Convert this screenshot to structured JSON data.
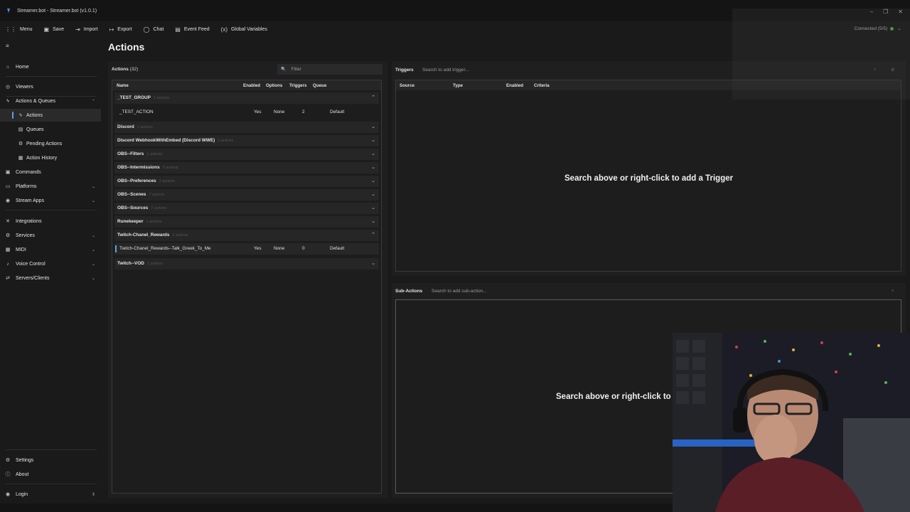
{
  "window": {
    "title": "Streamer.bot - Streamer.bot (v1.0.1)",
    "minimize": "–",
    "restore": "❐",
    "close": "✕"
  },
  "menubar": {
    "items": [
      {
        "icon": "grid-icon",
        "glyph": "⋮⋮",
        "label": "Menu"
      },
      {
        "icon": "save-icon",
        "glyph": "▣",
        "label": "Save"
      },
      {
        "icon": "import-icon",
        "glyph": "⇥",
        "label": "Import"
      },
      {
        "icon": "export-icon",
        "glyph": "↦",
        "label": "Export"
      },
      {
        "icon": "chat-icon",
        "glyph": "◯",
        "label": "Chat"
      },
      {
        "icon": "event-feed-icon",
        "glyph": "▤",
        "label": "Event Feed"
      },
      {
        "icon": "variables-icon",
        "glyph": "(x)",
        "label": "Global Variables"
      }
    ],
    "connection": "Connected (5/5)"
  },
  "sidebar": {
    "toggle": "≡",
    "items": [
      {
        "label": "Home",
        "icon": "home-icon",
        "glyph": "⌂"
      },
      {
        "label": "Viewers",
        "icon": "viewers-icon",
        "glyph": "◎"
      },
      {
        "label": "Actions & Queues",
        "icon": "lightning-icon",
        "glyph": "ϟ",
        "chev": "⌃"
      },
      {
        "label": "Actions",
        "icon": "lightning-icon",
        "glyph": "ϟ"
      },
      {
        "label": "Queues",
        "icon": "queue-icon",
        "glyph": "▤"
      },
      {
        "label": "Pending Actions",
        "icon": "pending-icon",
        "glyph": "⚙"
      },
      {
        "label": "Action History",
        "icon": "history-icon",
        "glyph": "▦"
      },
      {
        "label": "Commands",
        "icon": "commands-icon",
        "glyph": "▣"
      },
      {
        "label": "Platforms",
        "icon": "platforms-icon",
        "glyph": "▭",
        "chev": "⌄"
      },
      {
        "label": "Stream Apps",
        "icon": "stream-apps-icon",
        "glyph": "◉",
        "chev": "⌄"
      },
      {
        "label": "Integrations",
        "icon": "integrations-icon",
        "glyph": "✕"
      },
      {
        "label": "Services",
        "icon": "services-icon",
        "glyph": "⚙",
        "chev": "⌄"
      },
      {
        "label": "MIDI",
        "icon": "midi-icon",
        "glyph": "▦",
        "chev": "⌄"
      },
      {
        "label": "Voice Control",
        "icon": "mic-icon",
        "glyph": "♪",
        "chev": "⌄"
      },
      {
        "label": "Servers/Clients",
        "icon": "servers-icon",
        "glyph": "⇄",
        "chev": "⌄"
      },
      {
        "label": "Settings",
        "icon": "settings-icon",
        "glyph": "⚙"
      },
      {
        "label": "About",
        "icon": "about-icon",
        "glyph": "ⓘ"
      },
      {
        "label": "Login",
        "icon": "user-icon",
        "glyph": "◉",
        "chev": "⇕"
      }
    ]
  },
  "main": {
    "title": "Actions"
  },
  "actions": {
    "header": "Actions",
    "count": "(32)",
    "filter_placeholder": "Filter",
    "search_glyph": "🔍",
    "columns": [
      "Name",
      "Enabled",
      "Options",
      "Triggers",
      "Queue"
    ],
    "groups": [
      {
        "name": "_TEST_GROUP",
        "sub": "1 actions",
        "chev": "⌃"
      },
      {
        "name": "Discord",
        "sub": "1 actions",
        "chev": "⌄"
      },
      {
        "name": "Discord WebhookWithEmbed (Discord WWE)",
        "sub": "1 actions",
        "chev": "⌄"
      },
      {
        "name": "OBS--Filters",
        "sub": "1 actions",
        "chev": "⌄"
      },
      {
        "name": "OBS--Intermissions",
        "sub": "3 actions",
        "chev": "⌄"
      },
      {
        "name": "OBS--Preferences",
        "sub": "2 actions",
        "chev": "⌄"
      },
      {
        "name": "OBS--Scenes",
        "sub": "7 actions",
        "chev": "⌄"
      },
      {
        "name": "OBS--Sources",
        "sub": "7 actions",
        "chev": "⌄"
      },
      {
        "name": "Runekeeper",
        "sub": "1 actions",
        "chev": "⌄"
      },
      {
        "name": "Twitch-Chanel_Rewards",
        "sub": "1 actions",
        "chev": "⌃"
      },
      {
        "name": "Twitch--VOD",
        "sub": "1 actions",
        "chev": "⌄"
      }
    ],
    "rows": [
      {
        "name": "_TEST_ACTION",
        "enabled": "Yes",
        "options": "None",
        "triggers": "2",
        "queue": "Default"
      },
      {
        "name": "Twitch-Chanel_Rewards--Talk_Greek_To_Me",
        "enabled": "Yes",
        "options": "None",
        "triggers": "0",
        "queue": "Default"
      }
    ]
  },
  "triggers": {
    "label": "Triggers",
    "search_placeholder": "Search to add trigger...",
    "columns": [
      "Source",
      "Type",
      "Enabled",
      "Criteria"
    ],
    "empty": "Search above or right-click to add a Trigger"
  },
  "subactions": {
    "label": "Sub-Actions",
    "search_placeholder": "Search to add sub-action...",
    "empty": "Search above or right-click to"
  },
  "colors": {
    "accent": "#5aa0e6",
    "connected": "#4caf50"
  }
}
